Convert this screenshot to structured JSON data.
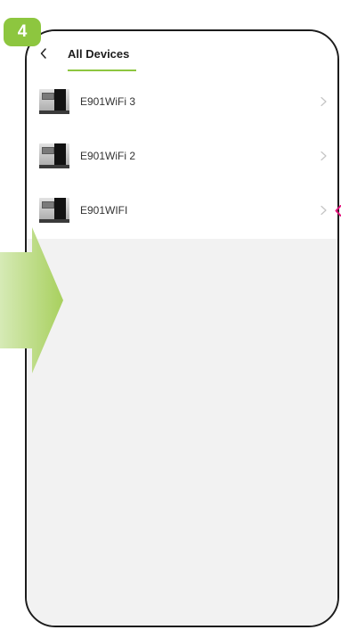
{
  "step_badge": "4",
  "header": {
    "back_icon": "chevron-left-icon",
    "title": "All Devices"
  },
  "devices": [
    {
      "name": "E901WiFi 3",
      "icon": "thermostat-controller-icon",
      "chevron_icon": "chevron-right-icon"
    },
    {
      "name": "E901WiFi 2",
      "icon": "thermostat-controller-icon",
      "chevron_icon": "chevron-right-icon"
    },
    {
      "name": "E901WIFI",
      "icon": "thermostat-controller-icon",
      "chevron_icon": "chevron-right-icon"
    }
  ],
  "annotations": {
    "step_arrow_icon": "right-arrow-icon",
    "pointer_icon": "pointer-arrow-icon"
  },
  "colors": {
    "accent": "#8dc63f",
    "arrow_light": "#d6eab6",
    "arrow_dark": "#a8d05e",
    "pointer": "#e3157d",
    "frame": "#1c1c1c",
    "empty_area": "#f2f2f2",
    "chevron": "#c4c4c4"
  }
}
